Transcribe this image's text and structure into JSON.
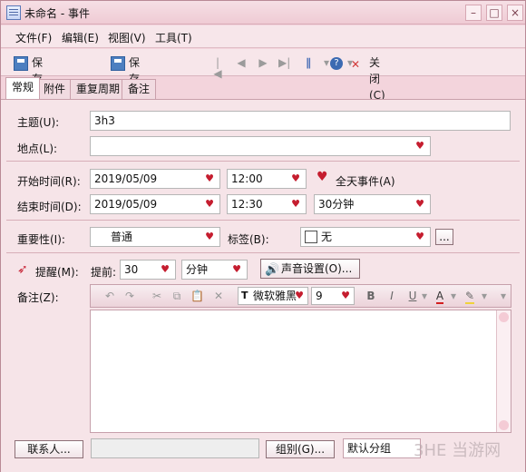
{
  "window": {
    "title": "未命名 - 事件"
  },
  "menu": [
    "文件(F)",
    "编辑(E)",
    "视图(V)",
    "工具(T)"
  ],
  "toolbar": {
    "save_close": "保存并关闭(S)",
    "save_add": "保存并增加(N)",
    "close": "关闭(C)"
  },
  "tabs": [
    "常规",
    "附件",
    "重复周期",
    "备注"
  ],
  "form": {
    "subject_label": "主题(U):",
    "subject_value": "3h3",
    "location_label": "地点(L):",
    "start_label": "开始时间(R):",
    "start_date": "2019/05/09",
    "start_time": "12:00",
    "all_day_label": "全天事件(A)",
    "end_label": "结束时间(D):",
    "end_date": "2019/05/09",
    "end_time": "12:30",
    "duration": "30分钟",
    "importance_label": "重要性(I):",
    "importance_value": "普通",
    "tag_label": "标签(B):",
    "tag_value": "无",
    "tag_more": "...",
    "reminder_label": "提醒(M):",
    "lead_label": "提前:",
    "lead_value": "30",
    "lead_unit": "分钟",
    "sound_label": "声音设置(O)...",
    "notes_label": "备注(Z):",
    "font_family": "微软雅黑",
    "font_size": "9",
    "contacts_button": "联系人...",
    "group_button": "组别(G)...",
    "group_value": "默认分组"
  },
  "watermark": "3HE 当游网",
  "colors": {
    "accent": "#c51d2f"
  }
}
